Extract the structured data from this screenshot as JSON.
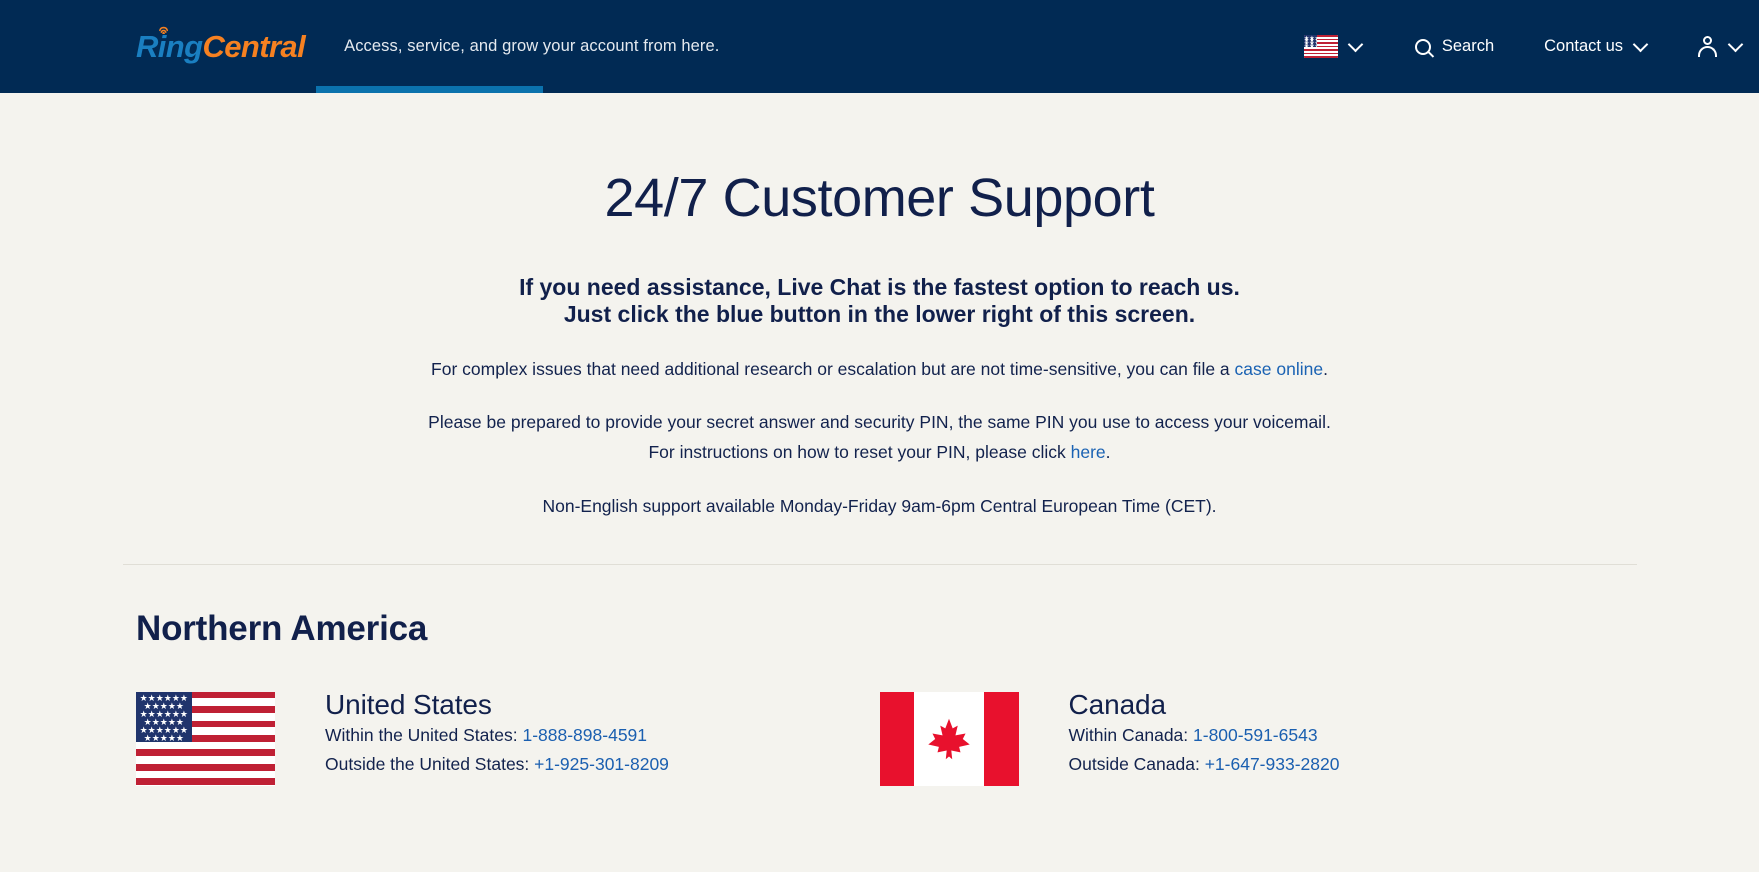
{
  "header": {
    "logo": {
      "part1": "Ring",
      "part2": "Central",
      "wifi_icon": "wifi-signal-icon"
    },
    "tagline": "Access, service, and grow your account from here.",
    "locale": {
      "name": "us-flag-icon",
      "label": "United States"
    },
    "search_label": "Search",
    "contact_label": "Contact us",
    "account_icon": "user-account-icon",
    "accent_tab_color": "#0b72ad",
    "background_color": "#012a54"
  },
  "main": {
    "title": "24/7 Customer Support",
    "lede_line1": "If you need assistance, Live Chat is the fastest option to reach us.",
    "lede_line2": "Just click the blue button in the lower right of this screen.",
    "para1_before": "For complex issues that need additional research or escalation but are not time-sensitive, you can file a ",
    "para1_link": "case online",
    "para1_after": ".",
    "para2_line1": "Please be prepared to provide your secret answer and security PIN, the same PIN you use to access your voicemail.",
    "para2_before": "For instructions on how to reset your PIN, please click ",
    "para2_link": "here",
    "para2_after": ".",
    "para3": "Non-English support available Monday-Friday 9am-6pm Central European Time (CET).",
    "link_color": "#1a62b3",
    "text_color": "#12224d"
  },
  "region": {
    "title": "Northern America",
    "countries": [
      {
        "name": "United States",
        "flag_icon": "us-flag-icon",
        "lines": [
          {
            "label": "Within the United States: ",
            "number": "1-888-898-4591"
          },
          {
            "label": "Outside the United States: ",
            "number": "+1-925-301-8209"
          }
        ]
      },
      {
        "name": "Canada",
        "flag_icon": "canada-flag-icon",
        "lines": [
          {
            "label": "Within Canada: ",
            "number": "1-800-591-6543"
          },
          {
            "label": "Outside Canada: ",
            "number": "+1-647-933-2820"
          }
        ]
      }
    ]
  }
}
